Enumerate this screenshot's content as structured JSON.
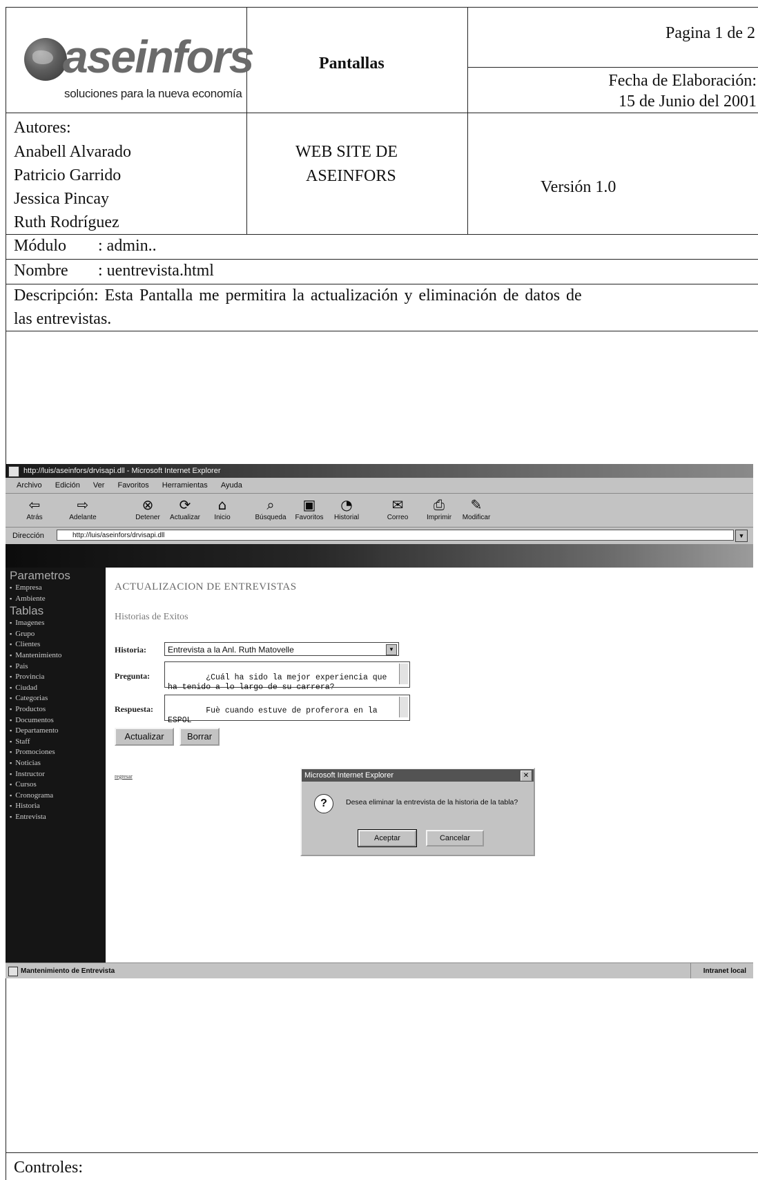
{
  "header": {
    "logo": {
      "name": "aseinfors",
      "tagline": "soluciones para la nueva economía"
    },
    "section_title": "Pantallas",
    "page_info": "Pagina 1 de 2",
    "date_label": "Fecha de Elaboración:",
    "date_value": "15 de Junio del 2001",
    "authors_label": "Autores:",
    "authors": [
      "Anabell Alvarado",
      "Patricio Garrido",
      "Jessica Pincay",
      "Ruth Rodríguez"
    ],
    "project_line1": "WEB SITE DE",
    "project_line2": "ASEINFORS",
    "version": "Versión 1.0"
  },
  "module": {
    "label": "Módulo",
    "value": ": admin.."
  },
  "name": {
    "label": "Nombre",
    "value": ": uentrevista.html"
  },
  "description": {
    "line1": "Descripción: Esta Pantalla me permitira la actualización y eliminación de datos de",
    "line2": "las entrevistas."
  },
  "browser": {
    "title": "http://luis/aseinfors/drvisapi.dll - Microsoft Internet Explorer",
    "menu": [
      "Archivo",
      "Edición",
      "Ver",
      "Favoritos",
      "Herramientas",
      "Ayuda"
    ],
    "toolbar": [
      {
        "label": "Atrás",
        "icon": "back-arrow-icon"
      },
      {
        "label": "Adelante",
        "icon": "forward-arrow-icon"
      },
      {
        "label": "Detener",
        "icon": "stop-icon"
      },
      {
        "label": "Actualizar",
        "icon": "refresh-icon"
      },
      {
        "label": "Inicio",
        "icon": "home-icon"
      },
      {
        "label": "Búsqueda",
        "icon": "search-icon"
      },
      {
        "label": "Favoritos",
        "icon": "favorites-icon"
      },
      {
        "label": "Historial",
        "icon": "history-icon"
      },
      {
        "label": "Correo",
        "icon": "mail-icon"
      },
      {
        "label": "Imprimir",
        "icon": "print-icon"
      },
      {
        "label": "Modificar",
        "icon": "edit-icon"
      }
    ],
    "address_label": "Dirección",
    "address_value": "http://luis/aseinfors/drvisapi.dll",
    "status_left": "Mantenimiento de Entrevista",
    "status_right": "Intranet local"
  },
  "sidebar": {
    "group1": "Parametros",
    "group1_items": [
      "Empresa",
      "Ambiente"
    ],
    "group2": "Tablas",
    "group2_items": [
      "Imagenes",
      "Grupo",
      "Clientes",
      "Mantenimiento",
      "Pais",
      "Provincia",
      "Ciudad",
      "Categorias",
      "Productos",
      "Documentos",
      "Departamento",
      "Staff",
      "Promociones",
      "Noticias",
      "Instructor",
      "Cursos",
      "Cronograma",
      "Historia",
      "Entrevista"
    ]
  },
  "form": {
    "heading": "ACTUALIZACION DE ENTREVISTAS",
    "subheading": "Historias de Exitos",
    "historia_label": "Historia:",
    "historia_value": "Entrevista a la Anl. Ruth Matovelle",
    "pregunta_label": "Pregunta:",
    "pregunta_value": "¿Cuál ha sido la mejor experiencia que\nha tenido a lo largo de su carrera?",
    "respuesta_label": "Respuesta:",
    "respuesta_value": "Fuè cuando estuve de proferora en la\nESPOL",
    "update_button": "Actualizar",
    "delete_button": "Borrar",
    "link": "regresar"
  },
  "dialog": {
    "title": "Microsoft Internet Explorer",
    "message": "Desea eliminar la entrevista de la historia de la tabla?",
    "ok": "Aceptar",
    "cancel": "Cancelar"
  },
  "footer": {
    "controls_label": "Controles:"
  }
}
